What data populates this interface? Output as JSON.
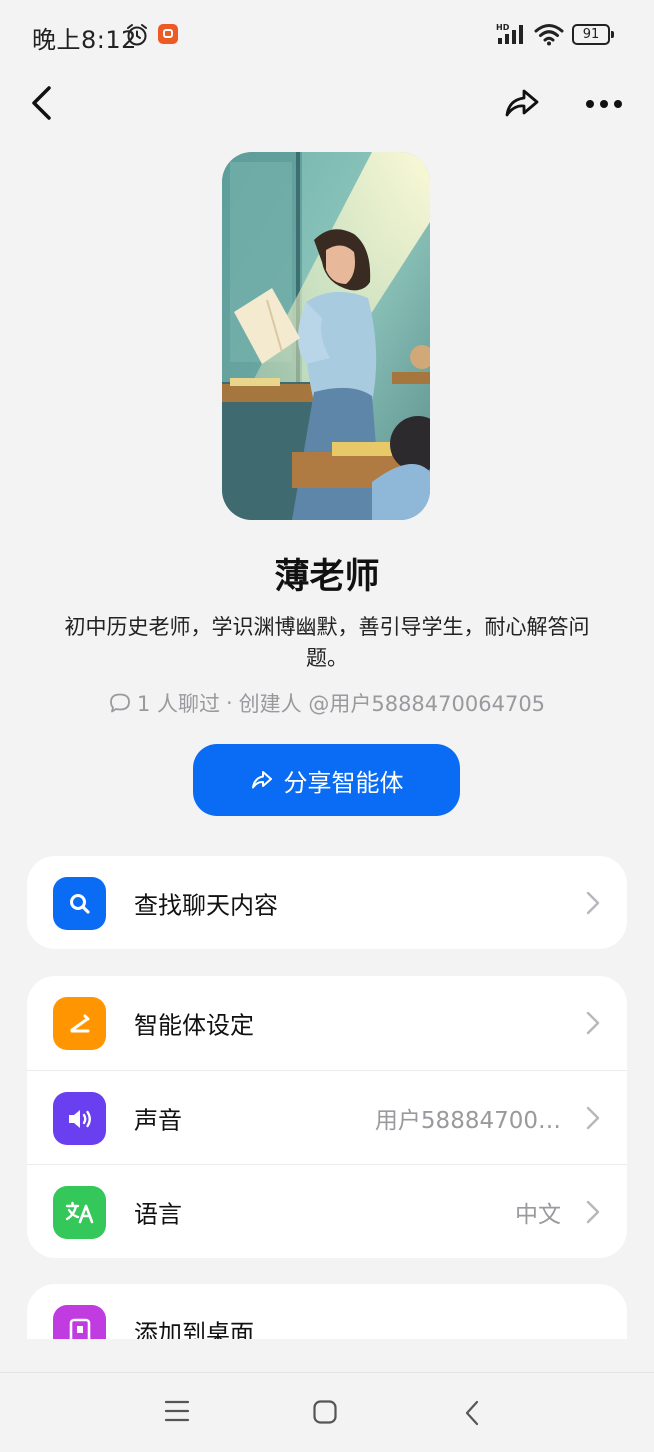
{
  "status_bar": {
    "time": "晚上8:12",
    "battery": "91"
  },
  "profile": {
    "name": "薄老师",
    "description": "初中历史老师，学识渊博幽默，善引导学生，耐心解答问题。",
    "chat_count": "1 人聊过",
    "separator": "·",
    "creator": "创建人 @用户5888470064705"
  },
  "share_button": {
    "label": "分享智能体"
  },
  "search_card": {
    "label": "查找聊天内容"
  },
  "settings_card": {
    "items": [
      {
        "label": "智能体设定",
        "value": "",
        "icon": "pencil-icon",
        "color": "#ff9500"
      },
      {
        "label": "声音",
        "value": "用户58884700…",
        "icon": "speaker-icon",
        "color": "#6a3ff0"
      },
      {
        "label": "语言",
        "value": "中文",
        "icon": "translate-icon",
        "color": "#34c759"
      }
    ]
  },
  "desktop_card": {
    "label": "添加到桌面"
  },
  "colors": {
    "accent": "#0a6cf5",
    "search_icon_bg": "#0a6cf5",
    "desktop_icon_bg": "#c13ce0"
  }
}
